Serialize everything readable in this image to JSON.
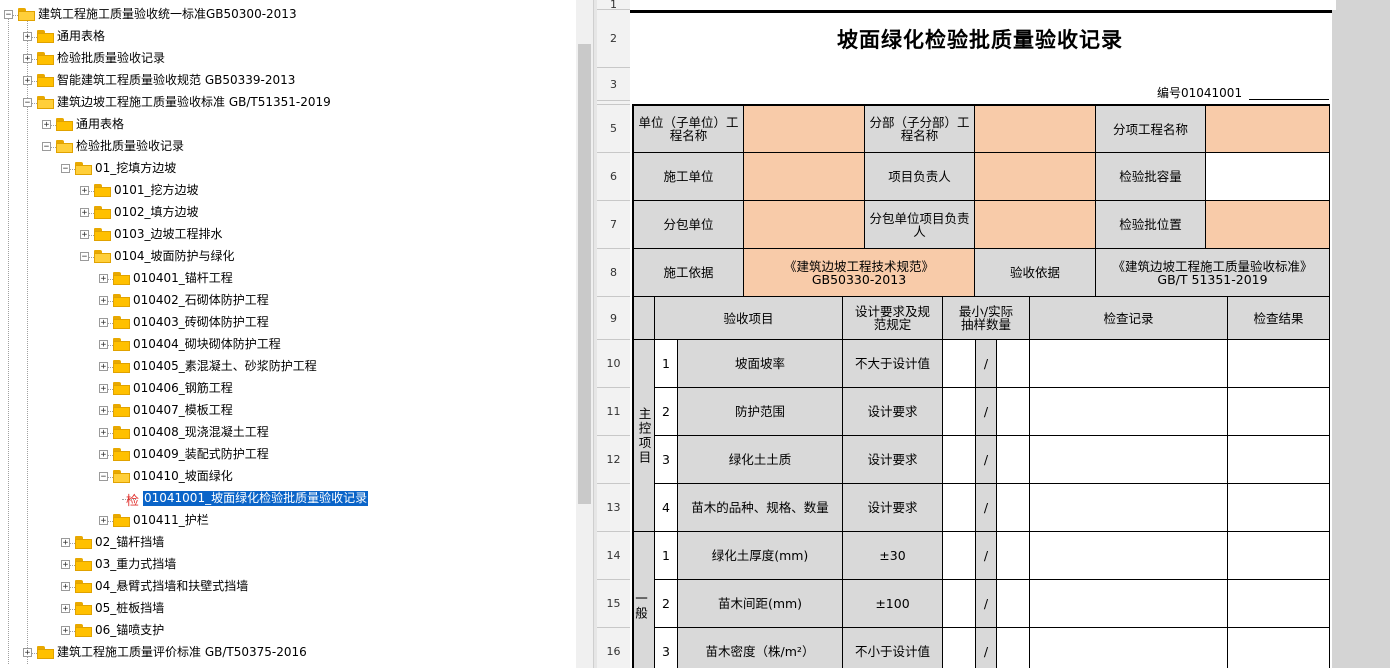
{
  "tree": {
    "nodes": [
      {
        "label": "建筑工程施工质量验收统一标准GB50300-2013"
      },
      {
        "label": "通用表格"
      },
      {
        "label": "检验批质量验收记录"
      },
      {
        "label": "智能建筑工程质量验收规范 GB50339-2013"
      },
      {
        "label": "建筑边坡工程施工质量验收标准 GB/T51351-2019"
      },
      {
        "label": "通用表格"
      },
      {
        "label": "检验批质量验收记录"
      },
      {
        "label": "01_挖填方边坡"
      },
      {
        "label": "0101_挖方边坡"
      },
      {
        "label": "0102_填方边坡"
      },
      {
        "label": "0103_边坡工程排水"
      },
      {
        "label": "0104_坡面防护与绿化"
      },
      {
        "label": "010401_锚杆工程"
      },
      {
        "label": "010402_石砌体防护工程"
      },
      {
        "label": "010403_砖砌体防护工程"
      },
      {
        "label": "010404_砌块砌体防护工程"
      },
      {
        "label": "010405_素混凝土、砂浆防护工程"
      },
      {
        "label": "010406_钢筋工程"
      },
      {
        "label": "010407_模板工程"
      },
      {
        "label": "010408_现浇混凝土工程"
      },
      {
        "label": "010409_装配式防护工程"
      },
      {
        "label": "010410_坡面绿化"
      },
      {
        "label": "01041001_坡面绿化检验批质量验收记录",
        "prefix": "检"
      },
      {
        "label": "010411_护栏"
      },
      {
        "label": "02_锚杆挡墙"
      },
      {
        "label": "03_重力式挡墙"
      },
      {
        "label": "04_悬臂式挡墙和扶壁式挡墙"
      },
      {
        "label": "05_桩板挡墙"
      },
      {
        "label": "06_锚喷支护"
      },
      {
        "label": "建筑工程施工质量评价标准 GB/T50375-2016"
      }
    ],
    "expand_symbol": "+",
    "collapse_symbol": "−"
  },
  "sheet": {
    "row_numbers": [
      "1",
      "2",
      "3",
      "4",
      "5",
      "6",
      "7",
      "8",
      "9",
      "10",
      "11",
      "12",
      "13",
      "14",
      "15",
      "16"
    ],
    "title": "坡面绿化检验批质量验收记录",
    "code_label": "编号01041001",
    "header": {
      "unit_label": "单位（子单位）工程名称",
      "division_label": "分部（子分部）工程名称",
      "subitem_label": "分项工程名称",
      "constructor_label": "施工单位",
      "project_leader_label": "项目负责人",
      "batch_capacity_label": "检验批容量",
      "subcontractor_label": "分包单位",
      "sub_leader_label": "分包单位项目负责人",
      "batch_location_label": "检验批位置",
      "basis_label": "施工依据",
      "basis_value": "《建筑边坡工程技术规范》GB50330-2013",
      "acceptance_basis_label": "验收依据",
      "acceptance_basis_value": "《建筑边坡工程施工质量验收标准》GB/T 51351-2019"
    },
    "columns": {
      "item": "验收项目",
      "design": "设计要求及规范规定",
      "sample": "最小/实际抽样数量",
      "record": "检查记录",
      "result": "检查结果"
    },
    "main_group": "主控项目",
    "general_group": "一般",
    "main_items": [
      {
        "no": "1",
        "name": "坡面坡率",
        "req": "不大于设计值",
        "slash": "/"
      },
      {
        "no": "2",
        "name": "防护范围",
        "req": "设计要求",
        "slash": "/"
      },
      {
        "no": "3",
        "name": "绿化土土质",
        "req": "设计要求",
        "slash": "/"
      },
      {
        "no": "4",
        "name": "苗木的品种、规格、数量",
        "req": "设计要求",
        "slash": "/"
      }
    ],
    "general_items": [
      {
        "no": "1",
        "name": "绿化土厚度(mm)",
        "req": "±30",
        "slash": "/"
      },
      {
        "no": "2",
        "name": "苗木间距(mm)",
        "req": "±100",
        "slash": "/"
      },
      {
        "no": "3",
        "name": "苗木密度（株/m²）",
        "req": "不小于设计值",
        "slash": "/"
      }
    ]
  },
  "colors": {
    "input_cell": "#f8cba9",
    "label_cell": "#d9d9d9",
    "selection": "#0a64c8"
  }
}
